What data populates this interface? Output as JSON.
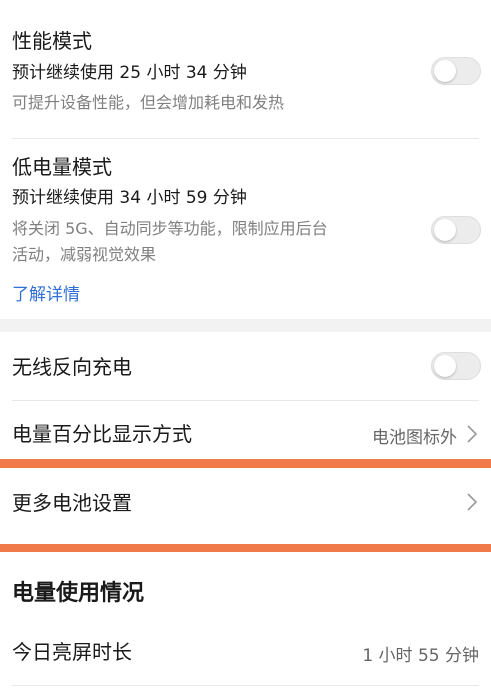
{
  "performance_mode": {
    "title": "性能模式",
    "estimate": "预计继续使用 25 小时 34 分钟",
    "description": "可提升设备性能，但会增加耗电和发热",
    "enabled": false
  },
  "low_power_mode": {
    "title": "低电量模式",
    "estimate": "预计继续使用 34 小时 59 分钟",
    "description_line1": "将关闭 5G、自动同步等功能，限制应用后台",
    "description_line2": "活动，减弱视觉效果",
    "learn_more": "了解详情",
    "enabled": false
  },
  "wireless_reverse_charging": {
    "title": "无线反向充电",
    "enabled": false
  },
  "battery_percentage": {
    "title": "电量百分比显示方式",
    "value": "电池图标外"
  },
  "more_settings": {
    "title": "更多电池设置"
  },
  "usage": {
    "section_title": "电量使用情况",
    "screen_on_label": "今日亮屏时长",
    "screen_on_value": "1 小时 55 分钟"
  },
  "colors": {
    "highlight": "#f07a4a",
    "link": "#2f6fd6",
    "toggle_off": "#ececec"
  }
}
